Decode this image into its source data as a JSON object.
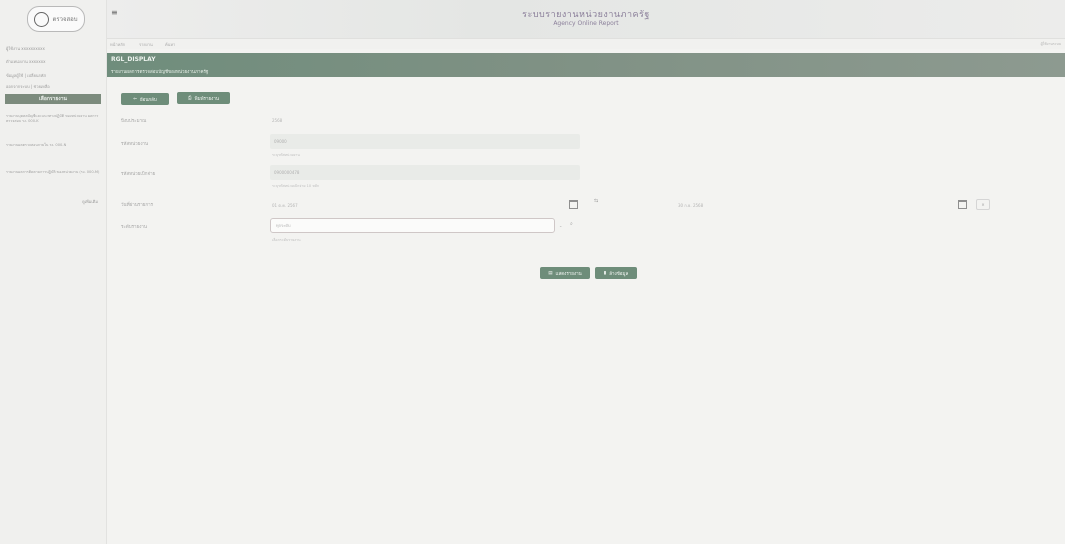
{
  "logo": {
    "text": "ตรวจสอบ"
  },
  "sidebar": {
    "lines": [
      "ผู้ใช้งาน xxxxxxxxxx",
      "ตำแหน่งงาน xxxxxxx",
      "ข้อมูลผู้ใช้ | เปลี่ยนรหัส",
      "ออกจากระบบ | ช่วยเหลือ"
    ],
    "menu_title": "เลือกรายงาน",
    "links": [
      "รายงานบุคคลบัญชีและแนวทางปฏิบัติ ของหน่วยงาน ผลการตรวจสอบ รง. 000-K",
      "รายงานผลตรวจสอบภายใน รง. 000-N",
      "รายงานผลการติดตามการปฏิบัติ ของหน่วยงาน (รง. 000-M)"
    ],
    "more": "ดูเพิ่มเติม"
  },
  "topbar": {
    "menu_glyph": "≡",
    "title": "ระบบรายงานหน่วยงานภาครัฐ",
    "subtitle": "Agency Online Report"
  },
  "breadcrumb": [
    "หน้าหลัก",
    "รายงาน",
    "ค้นหา"
  ],
  "user_tag": "ผู้ใช้งานระบบ",
  "banner": {
    "code": "RGL_DISPLAY",
    "title": "รายงานผลการตรวจสอบบัญชีของหน่วยงานภาครัฐ"
  },
  "actions": {
    "back_label": "ย้อนกลับ",
    "print_label": "พิมพ์รายงาน"
  },
  "form": {
    "rows": [
      {
        "label": "ปีงบประมาณ",
        "value": "2568"
      },
      {
        "label": "รหัสหน่วยงาน",
        "value": "09000",
        "help": "ระบุรหัสหน่วยงาน"
      },
      {
        "label": "รหัสหน่วยเบิกจ่าย",
        "value": "0900000478",
        "help": "ระบุรหัสหน่วยเบิกจ่าย 10 หลัก"
      },
      {
        "label": "วันที่ผ่านรายการ",
        "date_from": "01 ต.ค. 2567",
        "date_to": "30 ก.ย. 2568"
      },
      {
        "label": "ระดับรายงาน",
        "select_value": "ทุกระดับ",
        "help": "เลือกระดับรายงาน"
      }
    ]
  },
  "buttons": {
    "search_label": "แสดงรายงาน",
    "clear_label": "ล้างข้อมูล"
  },
  "colors": {
    "accent": "#6e8d7a",
    "banner": "#7a9182",
    "background": "#f3f3f1"
  }
}
